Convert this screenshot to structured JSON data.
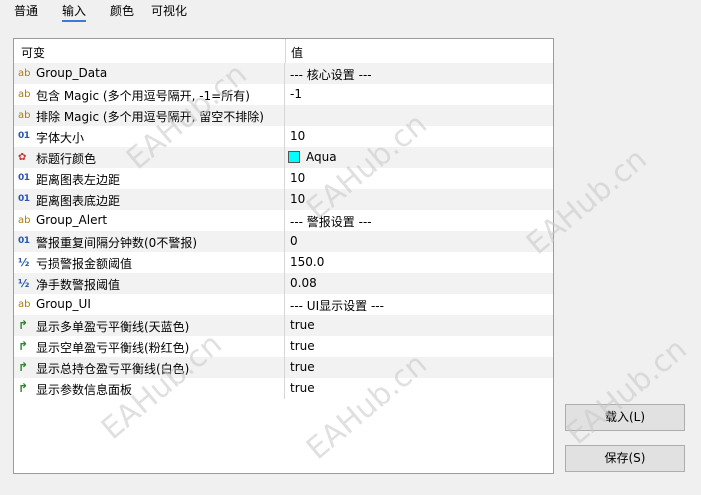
{
  "tabs": [
    "普通",
    "输入",
    "颜色",
    "可视化"
  ],
  "active_tab": "输入",
  "grid": {
    "col_name": "可变",
    "col_value": "值",
    "rows": [
      {
        "icon": "ab",
        "label": "Group_Data",
        "value": "--- 核心设置 ---"
      },
      {
        "icon": "ab",
        "label": "包含 Magic (多个用逗号隔开, -1=所有)",
        "value": "-1"
      },
      {
        "icon": "ab",
        "label": "排除 Magic (多个用逗号隔开, 留空不排除)",
        "value": ""
      },
      {
        "icon": "01",
        "label": "字体大小",
        "value": "10"
      },
      {
        "icon": "color",
        "label": "标题行颜色",
        "value": "Aqua",
        "swatch": "#00ffff"
      },
      {
        "icon": "01",
        "label": "距离图表左边距",
        "value": "10"
      },
      {
        "icon": "01",
        "label": "距离图表底边距",
        "value": "10"
      },
      {
        "icon": "ab",
        "label": "Group_Alert",
        "value": "--- 警报设置 ---"
      },
      {
        "icon": "01",
        "label": "警报重复间隔分钟数(0不警报)",
        "value": "0"
      },
      {
        "icon": "half",
        "label": "亏损警报金额阈值",
        "value": "150.0"
      },
      {
        "icon": "half",
        "label": "净手数警报阈值",
        "value": "0.08"
      },
      {
        "icon": "ab",
        "label": "Group_UI",
        "value": "--- UI显示设置 ---"
      },
      {
        "icon": "bool",
        "label": "显示多单盈亏平衡线(天蓝色)",
        "value": "true"
      },
      {
        "icon": "bool",
        "label": "显示空单盈亏平衡线(粉红色)",
        "value": "true"
      },
      {
        "icon": "bool",
        "label": "显示总持仓盈亏平衡线(白色)",
        "value": "true"
      },
      {
        "icon": "bool",
        "label": "显示参数信息面板",
        "value": "true"
      }
    ]
  },
  "buttons": {
    "load": "载入(L)",
    "save": "保存(S)"
  },
  "watermark": "EAHub.cn",
  "colors": {
    "accent": "#3a7bd5",
    "swatch_aqua": "#00ffff"
  }
}
